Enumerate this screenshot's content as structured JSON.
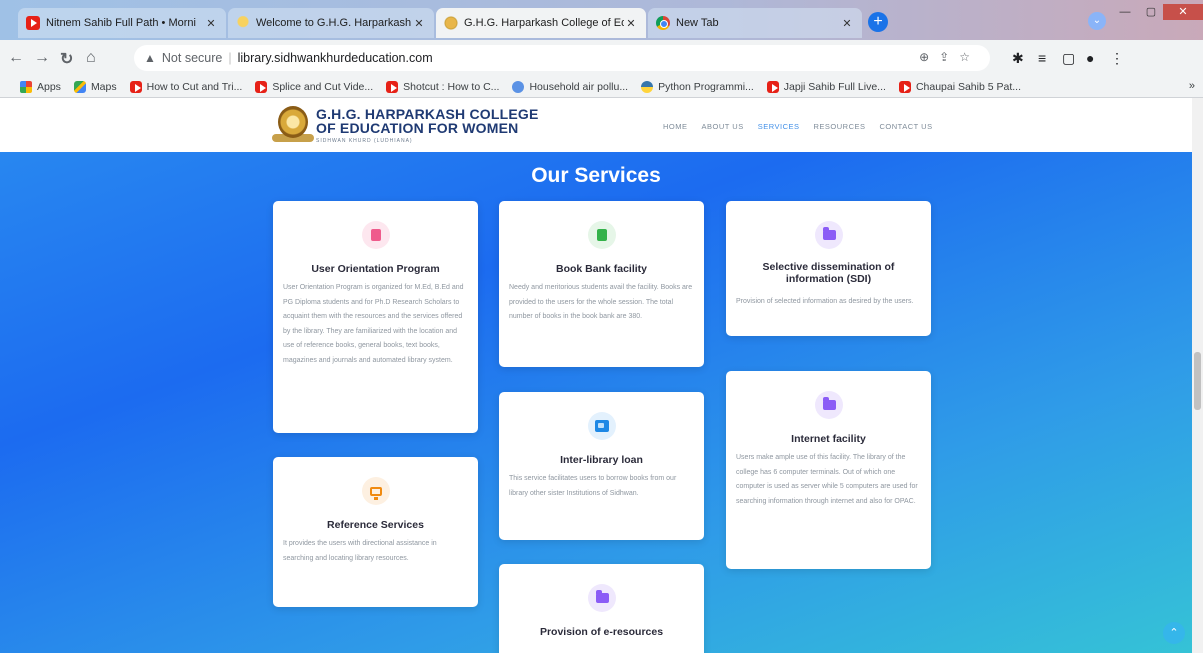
{
  "browser": {
    "tabs": [
      {
        "title": "Nitnem Sahib Full Path • Morni",
        "icon": "youtube-icon"
      },
      {
        "title": "Welcome to G.H.G. Harparkash C",
        "icon": "bulb-icon"
      },
      {
        "title": "G.H.G. Harparkash College of Ed",
        "icon": "college-logo-icon"
      },
      {
        "title": "New Tab",
        "icon": "chrome-icon"
      }
    ],
    "address": {
      "warning": "Not secure",
      "url": "library.sidhwankhurdeducation.com"
    },
    "bookmarks": [
      {
        "label": "Apps",
        "icon": "apps-icon"
      },
      {
        "label": "Maps",
        "icon": "maps-icon"
      },
      {
        "label": "How to Cut and Tri...",
        "icon": "youtube-icon"
      },
      {
        "label": "Splice and Cut Vide...",
        "icon": "youtube-icon"
      },
      {
        "label": "Shotcut : How to C...",
        "icon": "youtube-icon"
      },
      {
        "label": "Household air pollu...",
        "icon": "who-icon"
      },
      {
        "label": "Python Programmi...",
        "icon": "python-icon"
      },
      {
        "label": "Japji Sahib Full Live...",
        "icon": "youtube-icon"
      },
      {
        "label": "Chaupai Sahib 5 Pat...",
        "icon": "youtube-icon"
      }
    ]
  },
  "site": {
    "title_line1": "G.H.G. HARPARKASH COLLEGE",
    "title_line2": "OF EDUCATION FOR WOMEN",
    "subtitle": "SIDHWAN KHURD (LUDHIANA)",
    "menu": [
      "HOME",
      "ABOUT US",
      "SERVICES",
      "RESOURCES",
      "CONTACT US"
    ],
    "active_menu": "SERVICES"
  },
  "heading": "Our Services",
  "cards": {
    "orientation": {
      "title": "User Orientation Program",
      "body": "User Orientation Program is organized for M.Ed, B.Ed and PG Diploma students and for Ph.D Research Scholars to acquaint them with the resources and the services offered by the library. They are familiarized with the location and use of reference books, general books, text books, magazines and journals and automated library system.",
      "icon": "book-icon",
      "icon_color": "#ef5b8c",
      "icon_bg": "#fde7ef"
    },
    "bookbank": {
      "title": "Book Bank facility",
      "body": "Needy and meritorious students avail the facility. Books are provided to the users for the whole session. The total number of books in the book bank are 380.",
      "icon": "copy-documents-icon",
      "icon_color": "#34b24a",
      "icon_bg": "#e6f6e8"
    },
    "sdi": {
      "title": "Selective dissemination of information (SDI)",
      "body": "Provision of selected information as desired by the users.",
      "icon": "folder-icon",
      "icon_color": "#8b5cf6",
      "icon_bg": "#efe8fd"
    },
    "interlibrary": {
      "title": "Inter-library loan",
      "body": "This service facilitates users to borrow books from our library other sister Institutions of Sidhwan.",
      "icon": "exchange-icon",
      "icon_color": "#1e88e5",
      "icon_bg": "#e3f1fd"
    },
    "internet": {
      "title": "Internet facility",
      "body": "Users make ample use of this facility. The library of the college has 6 computer terminals. Out of which one computer is used as server while 5 computers are used for searching information through internet and also for OPAC.",
      "icon": "folder-icon",
      "icon_color": "#8b5cf6",
      "icon_bg": "#efe8fd"
    },
    "reference": {
      "title": "Reference Services",
      "body": "It provides the users with directional assistance in searching and locating library resources.",
      "icon": "monitor-icon",
      "icon_color": "#f08a10",
      "icon_bg": "#fdf0e1"
    },
    "eresources": {
      "title": "Provision of e-resources",
      "body": "",
      "icon": "folder-icon",
      "icon_color": "#8b5cf6",
      "icon_bg": "#efe8fd"
    }
  }
}
